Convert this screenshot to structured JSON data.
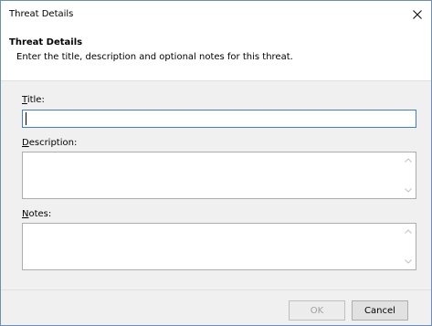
{
  "window": {
    "title": "Threat Details",
    "close_glyph": "✕"
  },
  "header": {
    "title": "Threat Details",
    "subtitle": "Enter the title, description and optional notes for this threat."
  },
  "fields": {
    "title_label": "Title:",
    "title_value": "",
    "description_label": "Description:",
    "description_value": "",
    "notes_label": "Notes:",
    "notes_value": ""
  },
  "buttons": {
    "ok": "OK",
    "ok_enabled": false,
    "cancel": "Cancel"
  },
  "icons": {
    "close": "close-icon",
    "scroll_up": "chevron-up-icon",
    "scroll_down": "chevron-down-icon"
  },
  "colors": {
    "focus_border": "#3d7fd1",
    "disabled_text": "#a0a0a0"
  }
}
